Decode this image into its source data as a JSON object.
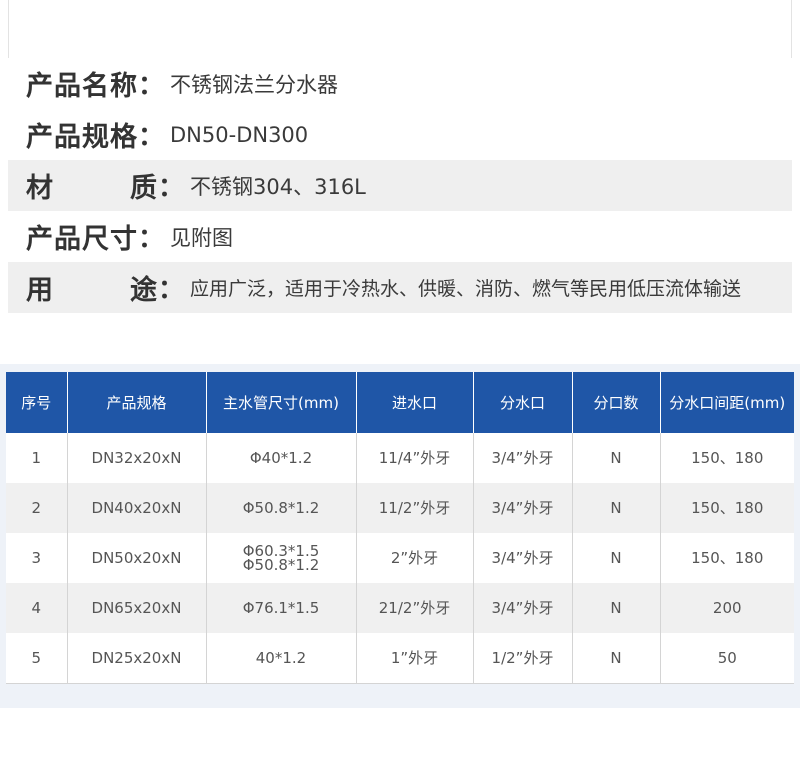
{
  "specs": [
    {
      "label": "产品名称",
      "value": "不锈钢法兰分水器"
    },
    {
      "label": "产品规格",
      "value": "DN50-DN300"
    },
    {
      "label_a": "材",
      "label_b": "质",
      "value": "不锈钢304、316L"
    },
    {
      "label": "产品尺寸",
      "value": "见附图"
    },
    {
      "label_a": "用",
      "label_b": "途",
      "value": "应用广泛，适用于冷热水、供暖、消防、燃气等民用低压流体输送"
    }
  ],
  "colon": "：",
  "table": {
    "headers": [
      "序号",
      "产品规格",
      "主水管尺寸(mm)",
      "进水口",
      "分水口",
      "分口数",
      "分水口间距(mm)"
    ],
    "rows": [
      [
        "1",
        "DN32x20xN",
        "Φ40*1.2",
        "11/4”外牙",
        "3/4”外牙",
        "N",
        "150、180"
      ],
      [
        "2",
        "DN40x20xN",
        "Φ50.8*1.2",
        "11/2”外牙",
        "3/4”外牙",
        "N",
        "150、180"
      ],
      [
        "3",
        "DN50x20xN",
        "Φ60.3*1.5",
        "2”外牙",
        "3/4”外牙",
        "N",
        "150、180"
      ],
      [
        "4",
        "DN65x20xN",
        "Φ76.1*1.5",
        "21/2”外牙",
        "3/4”外牙",
        "N",
        "200"
      ],
      [
        "5",
        "DN25x20xN",
        "40*1.2",
        "1”外牙",
        "1/2”外牙",
        "N",
        "50"
      ]
    ],
    "row3_pipe_line2": "Φ50.8*1.2"
  }
}
